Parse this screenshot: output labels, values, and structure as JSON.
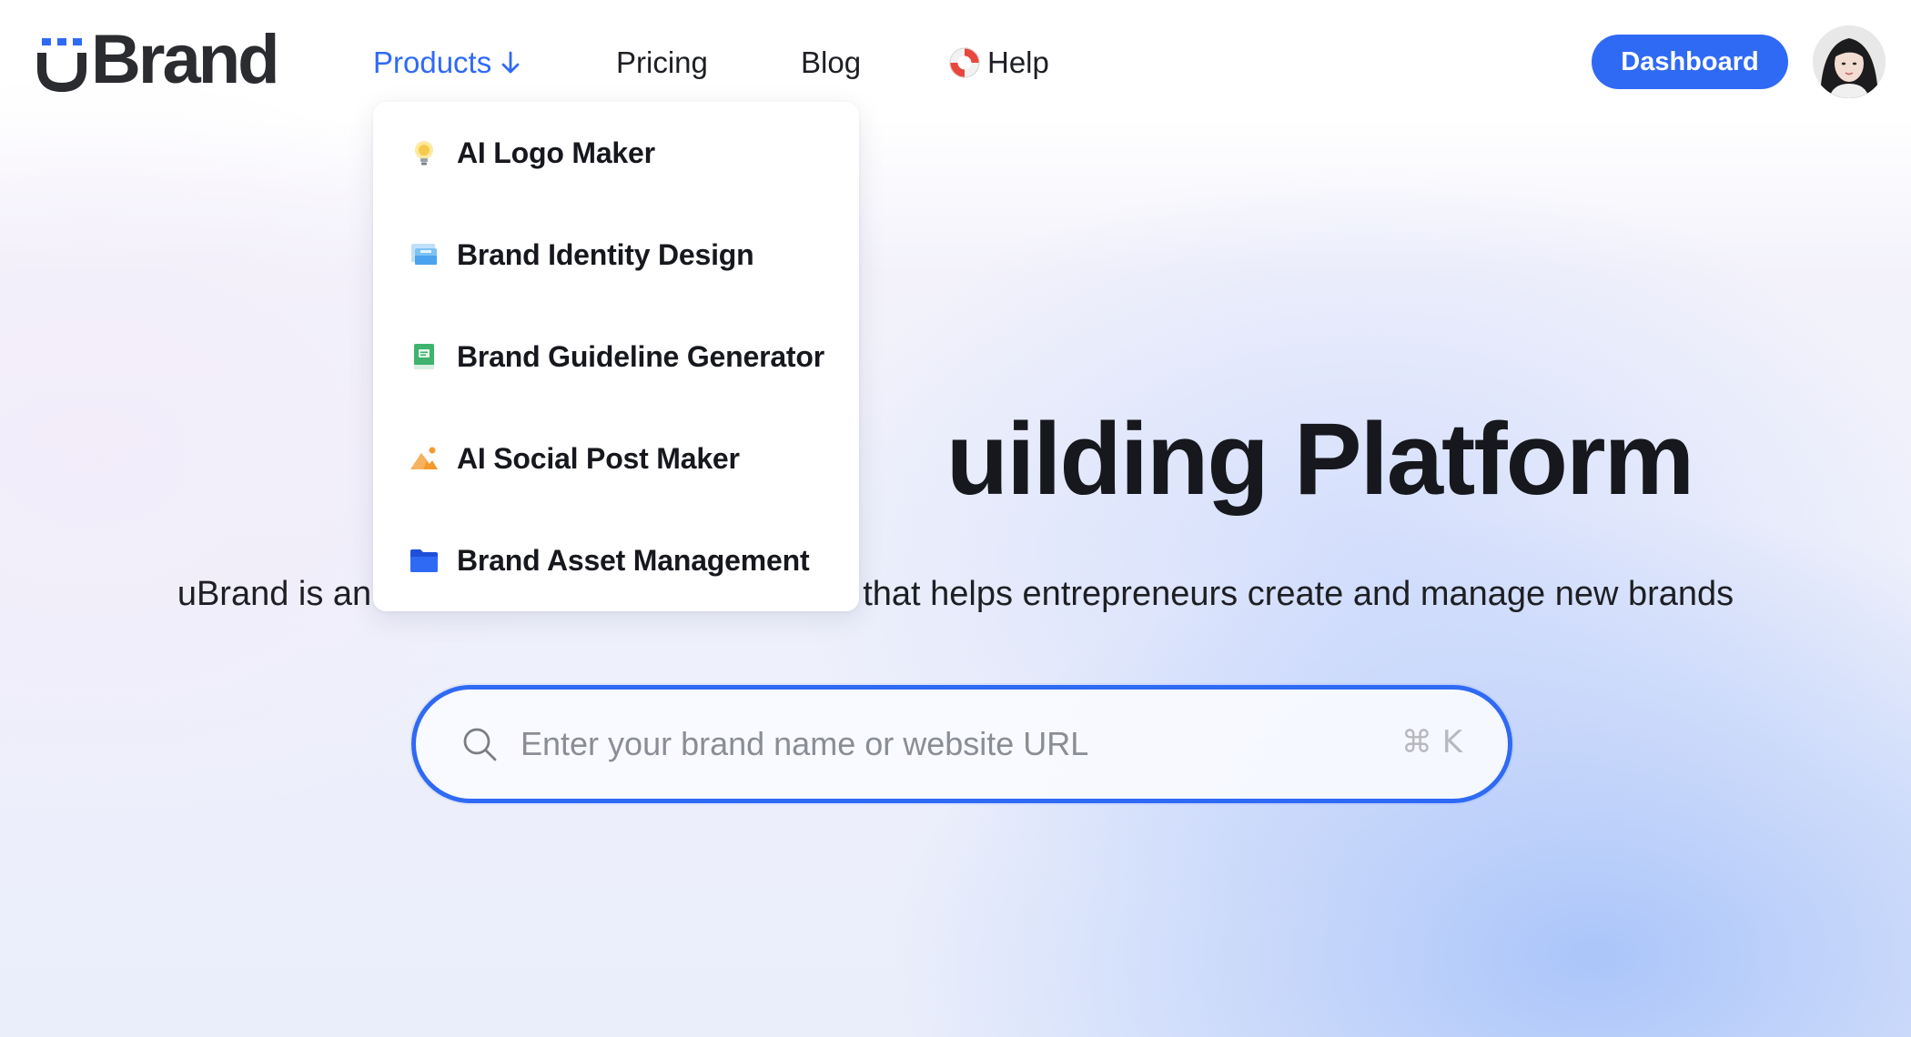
{
  "brand": {
    "logo_text": "Brand"
  },
  "nav": {
    "products": "Products",
    "pricing": "Pricing",
    "blog": "Blog",
    "help": "Help"
  },
  "header": {
    "dashboard_label": "Dashboard"
  },
  "products_menu": {
    "items": [
      {
        "label": "AI Logo Maker",
        "icon": "lightbulb-icon"
      },
      {
        "label": "Brand Identity Design",
        "icon": "identity-cards-icon"
      },
      {
        "label": "Brand Guideline Generator",
        "icon": "book-icon"
      },
      {
        "label": "AI Social Post Maker",
        "icon": "image-mountain-icon"
      },
      {
        "label": "Brand Asset Management",
        "icon": "folder-icon"
      }
    ]
  },
  "hero": {
    "title_visible": "uilding Platform",
    "subtitle_left": "uBrand is an",
    "subtitle_right": "that helps entrepreneurs create and manage new brands"
  },
  "search": {
    "placeholder": "Enter your brand name or website URL",
    "value": "",
    "shortcut": "⌘ K"
  },
  "colors": {
    "accent": "#2f6af4",
    "text": "#16181d",
    "placeholder": "#8a8d94"
  }
}
